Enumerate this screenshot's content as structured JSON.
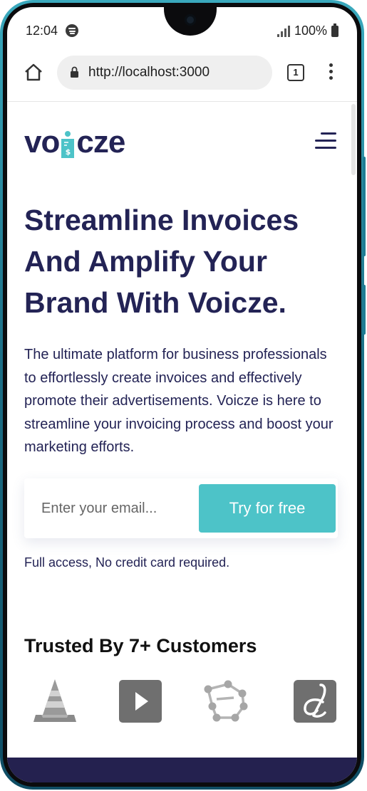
{
  "status_bar": {
    "time": "12:04",
    "battery": "100%",
    "icons": [
      "spotify-icon",
      "signal-icon",
      "battery-icon"
    ]
  },
  "browser": {
    "url": "http://localhost:3000",
    "tab_count": "1",
    "icons": [
      "home-icon",
      "lock-icon",
      "tabs-icon",
      "more-vert-icon"
    ]
  },
  "site": {
    "logo_prefix": "vo",
    "logo_suffix": "cze",
    "hero_title": "Streamline Invoices And Amplify Your Brand With Voicze.",
    "hero_description": "The ultimate platform for business professionals to effortlessly create invoices and effectively promote their advertisements. Voicze is here to streamline your invoicing process and boost your marketing efforts.",
    "email_placeholder": "Enter your email...",
    "email_value": "",
    "cta_label": "Try for free",
    "cta_note": "Full access, No credit card required.",
    "trusted_heading": "Trusted By 7+ Customers",
    "customer_logos": [
      "vlc-cone-icon",
      "play-icon",
      "polygon-network-icon",
      "script-d-icon"
    ]
  },
  "colors": {
    "brand_navy": "#232355",
    "accent_teal": "#4dc3c8",
    "footer_navy": "#24214f",
    "phone_frame": "#1d6f86"
  }
}
